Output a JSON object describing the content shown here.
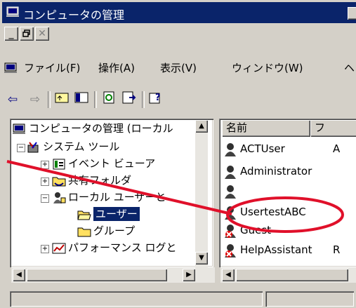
{
  "window": {
    "title": "コンピュータの管理"
  },
  "mdi_controls": {
    "minimize": "_",
    "restore": "🗗",
    "close": "✕"
  },
  "menu": {
    "items": [
      {
        "label": "ファイル(F)"
      },
      {
        "label": "操作(A)"
      },
      {
        "label": "表示(V)"
      },
      {
        "label": "ウィンドウ(W)"
      },
      {
        "label": "ヘ"
      }
    ]
  },
  "toolbar": {
    "back": "⇦",
    "forward": "⇨"
  },
  "tree": {
    "root": "コンピュータの管理 (ローカル",
    "items": [
      {
        "label": "システム ツール",
        "toggle": "−"
      },
      {
        "label": "イベント ビューア",
        "toggle": "+"
      },
      {
        "label": "共有フォルダ",
        "toggle": "+"
      },
      {
        "label": "ローカル ユーザーと",
        "toggle": "−"
      },
      {
        "label": "ユーザー",
        "toggle": ""
      },
      {
        "label": "グループ",
        "toggle": ""
      },
      {
        "label": "パフォーマンス ログと",
        "toggle": "+"
      }
    ]
  },
  "list": {
    "columns": [
      {
        "label": "名前"
      },
      {
        "label": "フ"
      }
    ],
    "rows": [
      {
        "name": "ACTUser",
        "extra": "A"
      },
      {
        "name": "Administrator",
        "extra": ""
      },
      {
        "name": "",
        "extra": ""
      },
      {
        "name": "UsertestABC",
        "extra": ""
      },
      {
        "name": "Guest",
        "extra": ""
      },
      {
        "name": "HelpAssistant",
        "extra": "R"
      }
    ]
  },
  "colors": {
    "titlebar": "#0a246a",
    "selection": "#0a246a",
    "annotation": "#e0102a",
    "chrome": "#d4d0c8"
  }
}
